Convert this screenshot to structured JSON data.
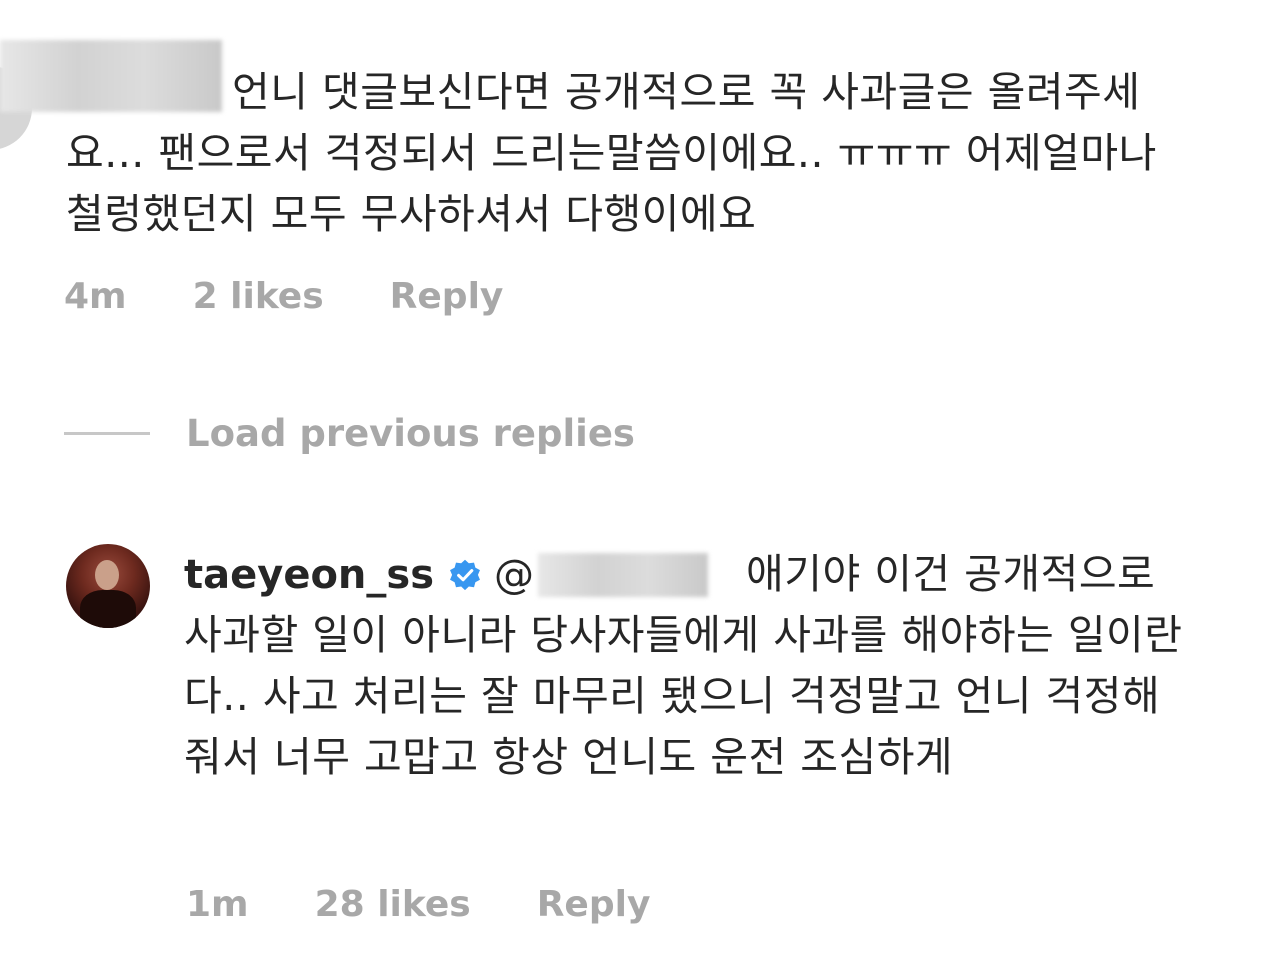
{
  "comment1": {
    "text": "언니 댓글보신다면 공개적으로 꼭 사과글은 올려주세요... 팬으로서 걱정되서 드리는말씀이에요.. ㅠㅠㅠ 어제얼마나 철렁했던지 모두 무사하셔서 다행이에요",
    "time": "4m",
    "likes": "2 likes",
    "reply_label": "Reply"
  },
  "load_previous": {
    "label": "Load previous replies"
  },
  "comment2": {
    "username": "taeyeon_ss",
    "verified_icon": "verified-badge-icon",
    "verified_color": "#3897f0",
    "mention_prefix": "@",
    "text": "애기야 이건 공개적으로 사과할 일이 아니라 당사자들에게 사과를 해야하는 일이란다.. 사고 처리는 잘 마무리 됐으니 걱정말고 언니 걱정해줘서 너무 고맙고 항상 언니도 운전 조심하게",
    "time": "1m",
    "likes": "28 likes",
    "reply_label": "Reply"
  }
}
